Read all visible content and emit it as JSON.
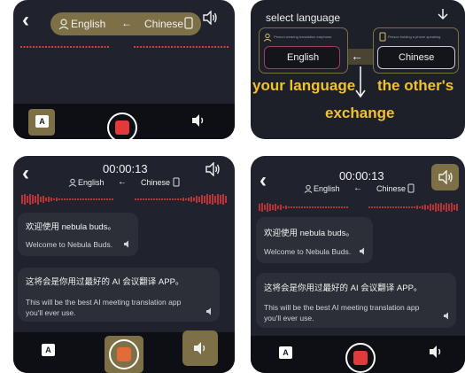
{
  "panel1": {
    "lang_from": "English",
    "arrow": "←",
    "lang_to": "Chinese"
  },
  "panel2": {
    "title": "select language",
    "tiny_left": "Person wearing translation earphone",
    "tiny_right": "Person holding a phone speaking",
    "btn_left": "English",
    "btn_right": "Chinese",
    "caption_left": "your language",
    "caption_right": "the other's",
    "caption_bottom": "exchange"
  },
  "panel3": {
    "timer": "00:00:13",
    "lang_from": "English",
    "arrow": "←",
    "lang_to": "Chinese",
    "msg1_zh": "欢迎使用 nebula buds。",
    "msg1_en": "Welcome to Nebula Buds.",
    "msg2_zh": "这将会是你用过最好的 AI 会议翻译 APP。",
    "msg2_en_line1": "This will be the best AI meeting translation app",
    "msg2_en_line2": "you'll ever use."
  },
  "panel4": {
    "timer": "00:00:13",
    "lang_from": "English",
    "arrow": "←",
    "lang_to": "Chinese",
    "msg1_zh": "欢迎使用 nebula buds。",
    "msg1_en": "Welcome to Nebula Buds.",
    "msg2_zh": "这将会是你用过最好的 AI 会议翻译 APP。",
    "msg2_en_line1": "This will be the best AI meeting translation app",
    "msg2_en_line2": "you'll ever use."
  },
  "icons": {
    "A_label": "A"
  },
  "colors": {
    "panel_bg": "#20232d",
    "bar_bg": "#0d0f14",
    "wave_red": "#e23a3a",
    "highlight_olive": "#7d7047",
    "caption_yellow": "#f2c12e",
    "record_red": "#e23a3a"
  }
}
